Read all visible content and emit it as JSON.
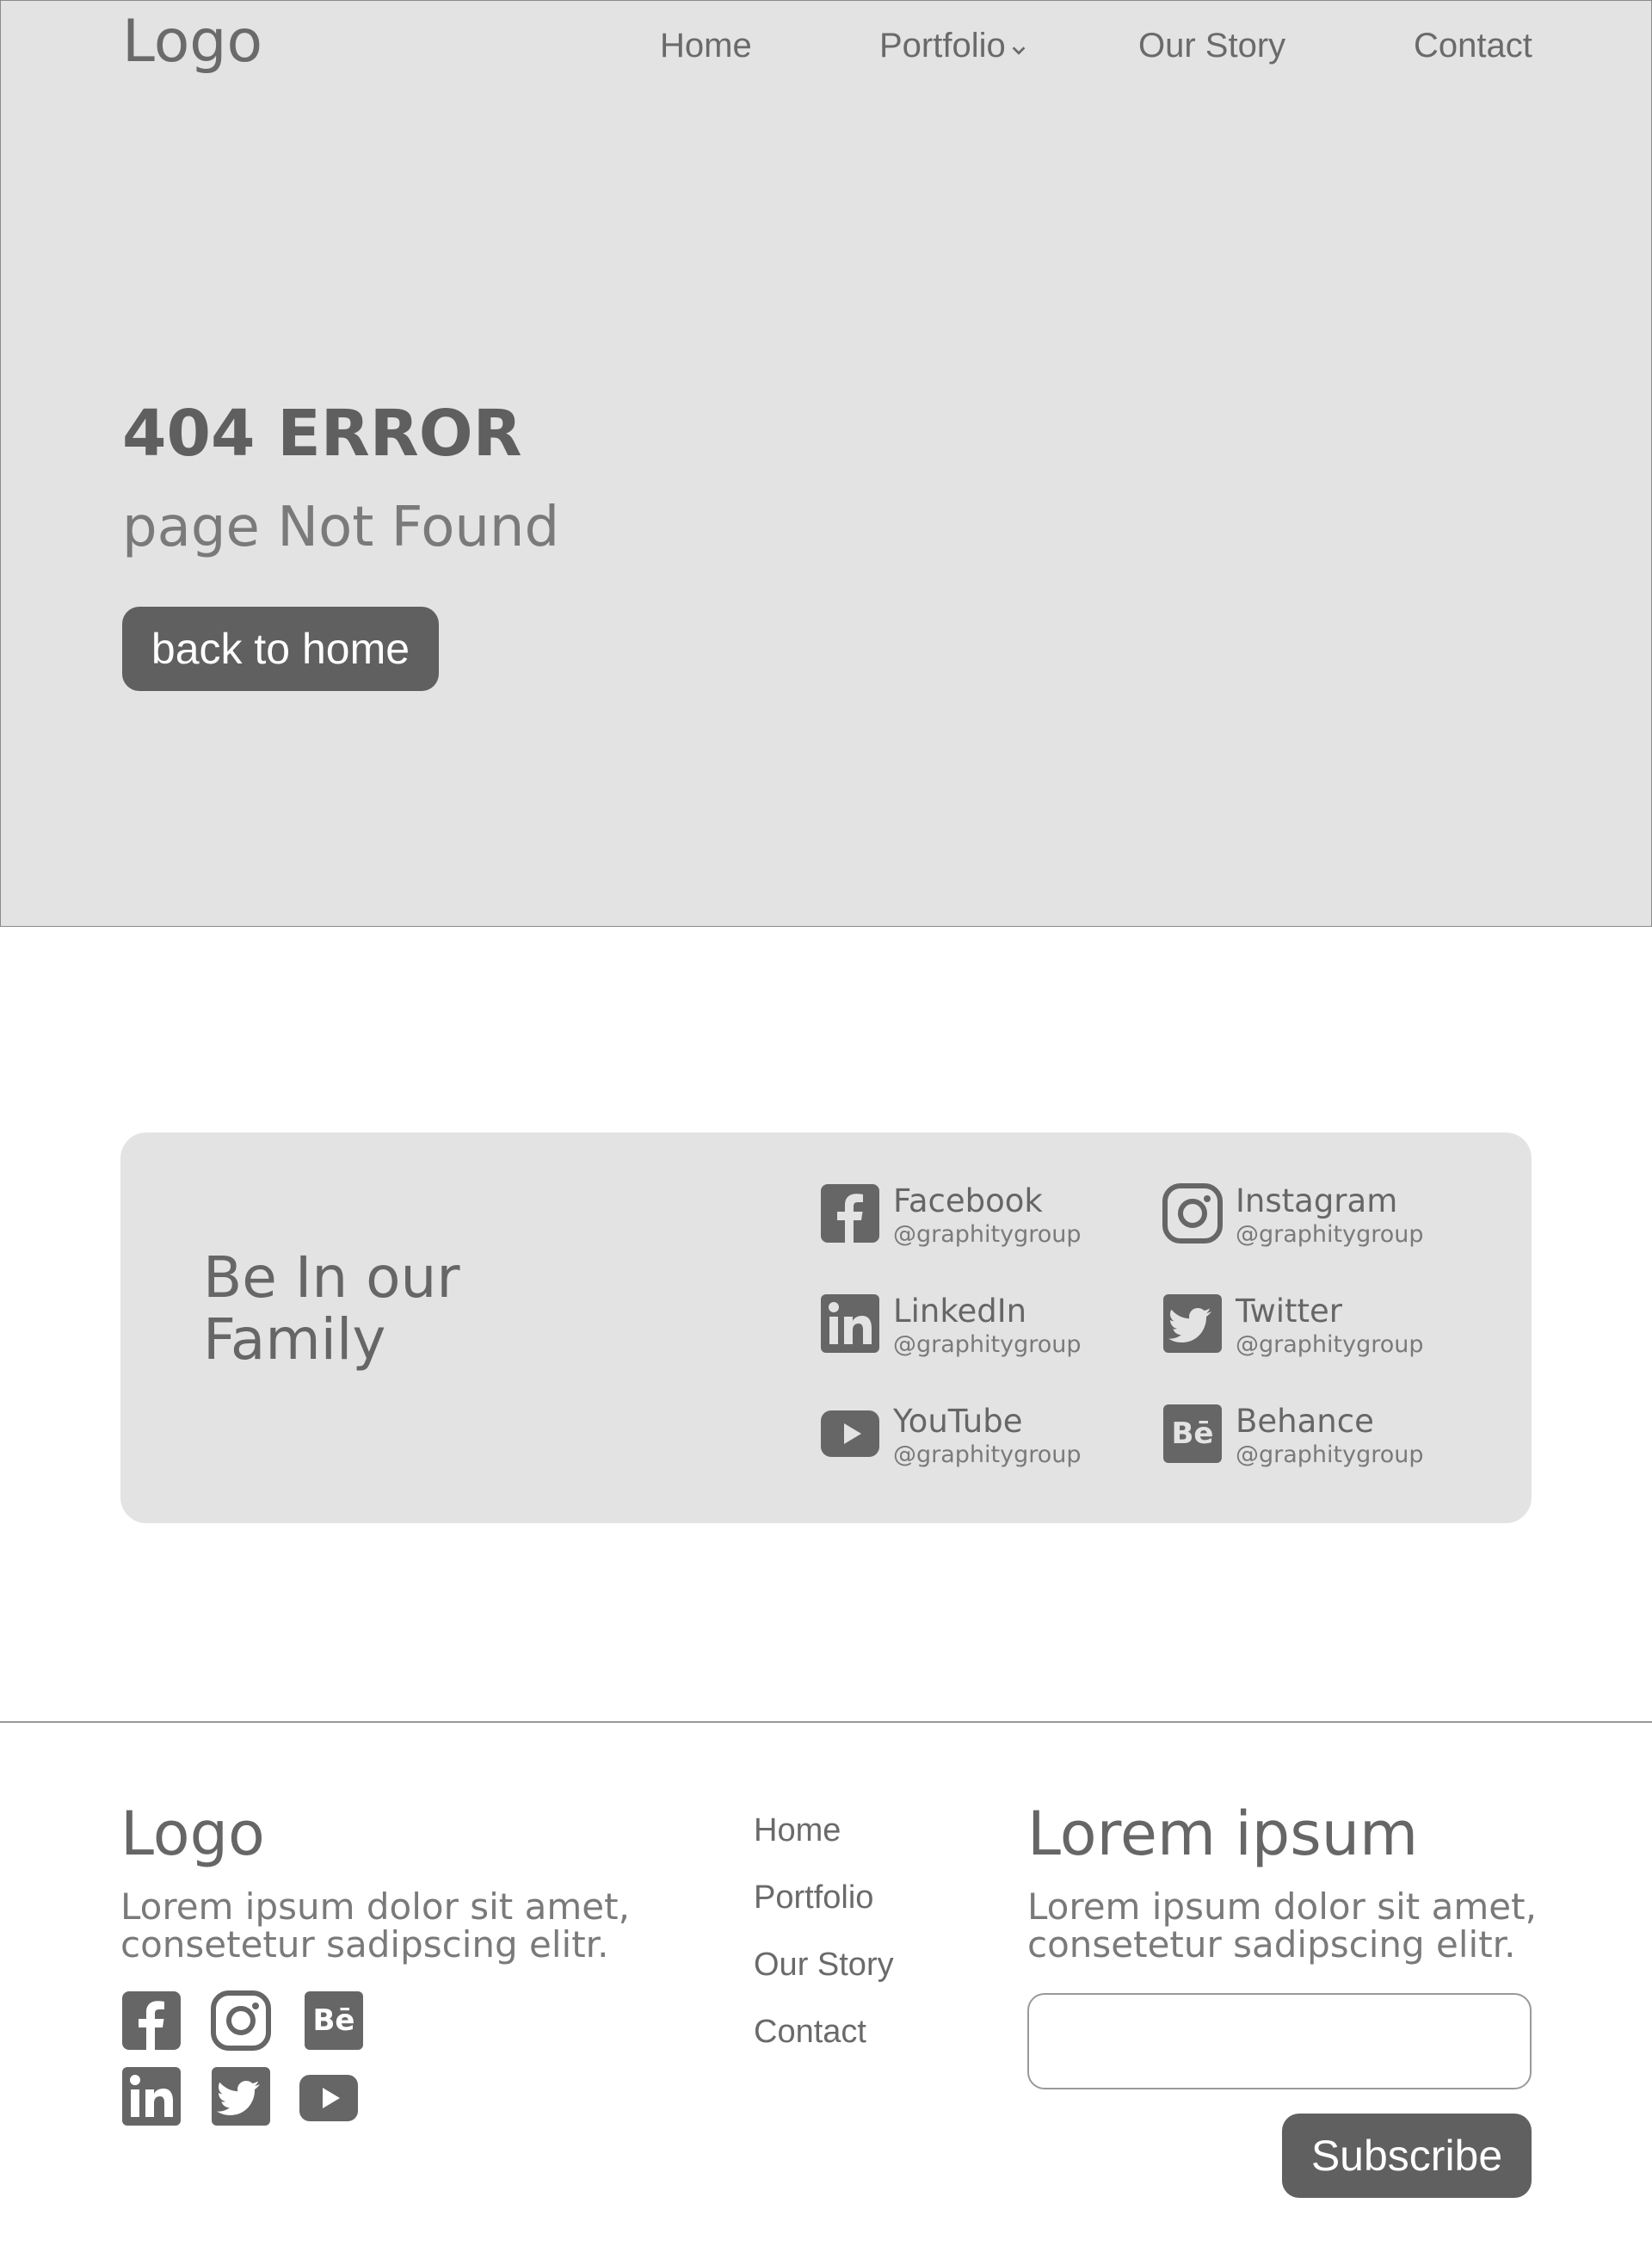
{
  "header": {
    "logo": "Logo",
    "nav": [
      "Home",
      "Portfolio",
      "Our Story",
      "Contact"
    ]
  },
  "hero": {
    "title": "404 ERROR",
    "subtitle": "page Not Found",
    "button": "back to home"
  },
  "family": {
    "title": "Be In our Family",
    "socials": [
      {
        "name": "Facebook",
        "handle": "@graphitygroup",
        "icon": "facebook-icon"
      },
      {
        "name": "Instagram",
        "handle": "@graphitygroup",
        "icon": "instagram-icon"
      },
      {
        "name": "LinkedIn",
        "handle": "@graphitygroup",
        "icon": "linkedin-icon"
      },
      {
        "name": "Twitter",
        "handle": "@graphitygroup",
        "icon": "twitter-icon"
      },
      {
        "name": "YouTube",
        "handle": "@graphitygroup",
        "icon": "youtube-icon"
      },
      {
        "name": "Behance",
        "handle": "@graphitygroup",
        "icon": "behance-icon"
      }
    ]
  },
  "footer": {
    "logo": "Logo",
    "description": "Lorem ipsum dolor sit amet, consetetur sadipscing elitr.",
    "nav": [
      "Home",
      "Portfolio",
      "Our Story",
      "Contact"
    ],
    "newsletter_title": "Lorem ipsum",
    "newsletter_description": "Lorem ipsum dolor sit amet, consetetur sadipscing elitr.",
    "email_value": "",
    "subscribe_label": "Subscribe"
  },
  "colors": {
    "hero_bg": "#e3e3e3",
    "button_bg": "#606060",
    "text": "#666666"
  }
}
